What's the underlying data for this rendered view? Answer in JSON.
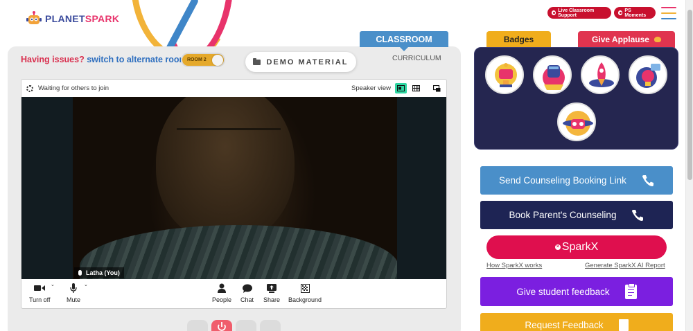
{
  "brand": {
    "name_part1": "PLANET",
    "name_part2": "SPARK"
  },
  "header": {
    "live_support_label": "Live Classroom Support",
    "ps_moments_label": "PS Moments",
    "menu_icon": "hamburger-menu-icon"
  },
  "classroom": {
    "issues_prefix": "Having issues?",
    "issues_link": "switch to alternate room",
    "room_toggle_label": "ROOM 2",
    "demo_material_label": "DEMO MATERIAL",
    "tab_classroom": "CLASSROOM",
    "tab_curriculum": "CURRICULUM"
  },
  "meeting": {
    "status": "Waiting for others to join",
    "speaker_view_label": "Speaker view",
    "participant_name": "Latha (You)",
    "controls": [
      {
        "label": "Turn off",
        "icon": "camera-icon"
      },
      {
        "label": "Mute",
        "icon": "microphone-icon"
      },
      {
        "label": "People",
        "icon": "people-icon"
      },
      {
        "label": "Chat",
        "icon": "chat-icon"
      },
      {
        "label": "Share",
        "icon": "share-icon"
      },
      {
        "label": "Background",
        "icon": "background-icon"
      }
    ]
  },
  "badges": {
    "tab_label": "Badges",
    "applause_label": "Give Applause",
    "items": [
      "trophy-badge-icon",
      "fist-badge-icon",
      "rocket-badge-icon",
      "lightbulb-badge-icon",
      "robot-badge-icon"
    ]
  },
  "actions": {
    "send_counseling": "Send Counseling Booking Link",
    "book_parent": "Book Parent's Counseling",
    "sparkx": "SparkX",
    "how_sparkx": "How SparkX works",
    "generate_report": "Generate SparkX AI Report",
    "student_feedback": "Give student feedback",
    "request_feedback": "Request Feedback"
  },
  "colors": {
    "accent_blue": "#4a8fc9",
    "accent_red": "#c8102e",
    "navy": "#1e2454",
    "purple": "#7b1fe0",
    "amber": "#f0ad1c"
  }
}
